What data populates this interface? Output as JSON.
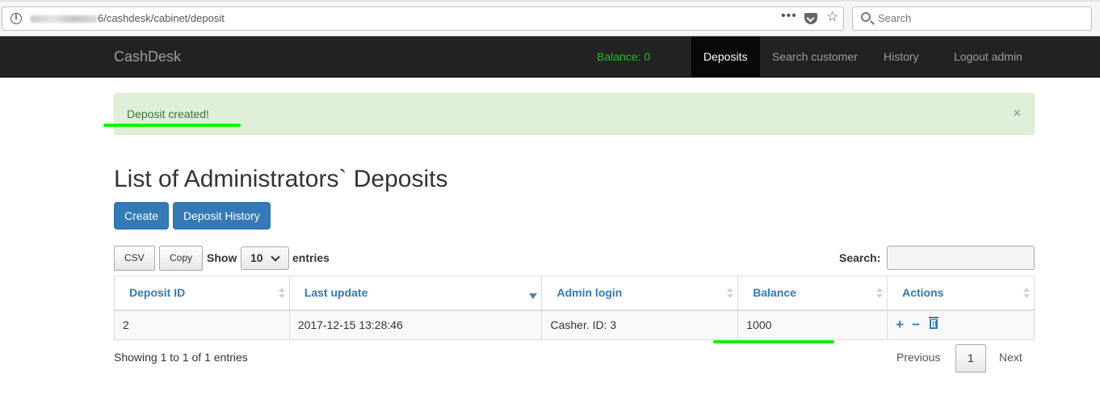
{
  "browser": {
    "url_visible": "6/cashdesk/cabinet/deposit",
    "search_placeholder": "Search",
    "info_icon": "i",
    "menu_dots": "•••",
    "star_icon": "☆"
  },
  "navbar": {
    "brand": "CashDesk",
    "balance": "Balance: 0",
    "items": [
      {
        "label": "Deposits",
        "active": true
      },
      {
        "label": "Search customer",
        "active": false
      },
      {
        "label": "History",
        "active": false
      },
      {
        "label": "Logout admin",
        "active": false
      }
    ]
  },
  "alert": {
    "message": "Deposit created!",
    "close": "×"
  },
  "page": {
    "title": "List of Administrators` Deposits",
    "buttons": {
      "create": "Create",
      "history": "Deposit History"
    }
  },
  "table_controls": {
    "csv": "CSV",
    "copy": "Copy",
    "show": "Show",
    "entries_value": "10",
    "entries": "entries",
    "search_label": "Search:"
  },
  "table": {
    "columns": [
      "Deposit ID",
      "Last update",
      "Admin login",
      "Balance",
      "Actions"
    ],
    "rows": [
      [
        "2",
        "2017-12-15 13:28:46",
        "Casher. ID: 3",
        "1000"
      ]
    ],
    "actions": {
      "add": "+",
      "remove": "−"
    }
  },
  "footer": {
    "info": "Showing 1 to 1 of 1 entries",
    "previous": "Previous",
    "page": "1",
    "next": "Next"
  },
  "colors": {
    "primary": "#337ab7",
    "navbar": "#222222",
    "alert_bg": "#dff0d8",
    "alert_text": "#3c763d",
    "balance": "#1bbf1b",
    "annotation": "#12f012"
  }
}
